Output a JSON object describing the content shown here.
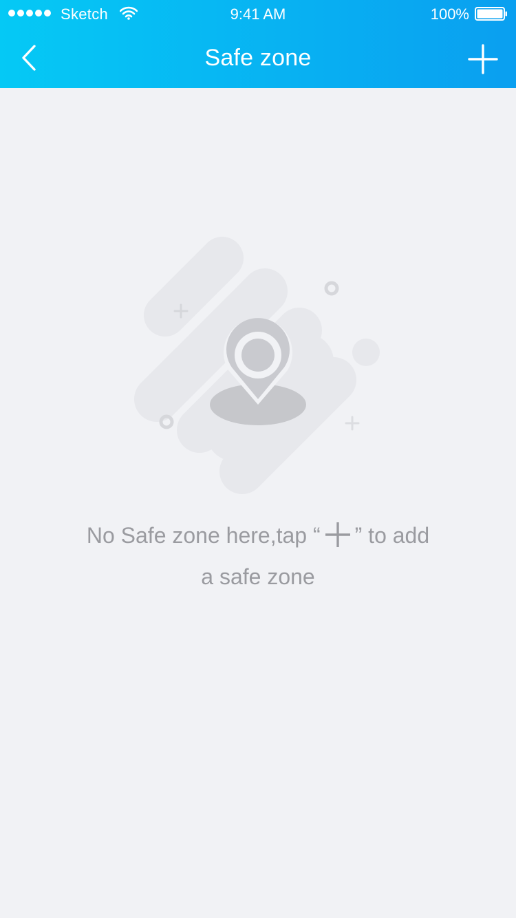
{
  "status_bar": {
    "carrier": "Sketch",
    "time": "9:41 AM",
    "battery": "100%",
    "signal_icon": "signal-dots-icon",
    "wifi_icon": "wifi-icon",
    "battery_icon": "battery-icon"
  },
  "nav": {
    "title": "Safe zone",
    "back_icon": "chevron-left-icon",
    "add_icon": "plus-icon"
  },
  "empty_state": {
    "illustration_icon": "map-pin-icon",
    "message_before": "No Safe zone here,tap “",
    "message_after": "” to add",
    "message_line2": "a safe zone"
  },
  "colors": {
    "header_gradient_start": "#05c9f5",
    "header_gradient_end": "#0a9ff0",
    "background": "#f1f2f5",
    "muted_text": "#9a9ba0",
    "illustration_light": "#e7e8ec",
    "illustration_mid": "#cfd0d4"
  }
}
